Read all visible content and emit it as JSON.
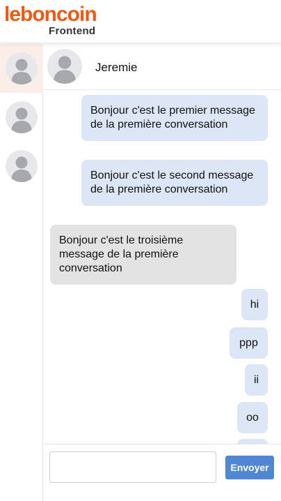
{
  "header": {
    "logo_text": "leboncoin",
    "logo_subtitle": "Frontend",
    "logo_color": "#ec5a13"
  },
  "sidebar": {
    "conversations": [
      {
        "avatar": "user-avatar-icon",
        "active": true
      },
      {
        "avatar": "user-avatar-icon",
        "active": false
      },
      {
        "avatar": "user-avatar-icon",
        "active": false
      }
    ]
  },
  "chat": {
    "contact_name": "Jeremie",
    "messages": [
      {
        "text": "Bonjour c'est le premier message de la première conversation",
        "direction": "out"
      },
      {
        "text": "Bonjour c'est le second message de la première conversation",
        "direction": "out"
      },
      {
        "text": "Bonjour c'est le troisième message de la première conversation",
        "direction": "in"
      },
      {
        "text": "hi",
        "direction": "out"
      },
      {
        "text": "ppp",
        "direction": "out"
      },
      {
        "text": "ii",
        "direction": "out"
      },
      {
        "text": "oo",
        "direction": "out"
      },
      {
        "text": "",
        "direction": "out"
      }
    ]
  },
  "composer": {
    "input_value": "",
    "input_placeholder": "",
    "send_label": "Envoyer"
  },
  "colors": {
    "outgoing_bubble": "#dce6f4",
    "incoming_bubble": "#e3e3e3",
    "send_button": "#4f87d4",
    "active_conversation": "#fbeee8"
  }
}
